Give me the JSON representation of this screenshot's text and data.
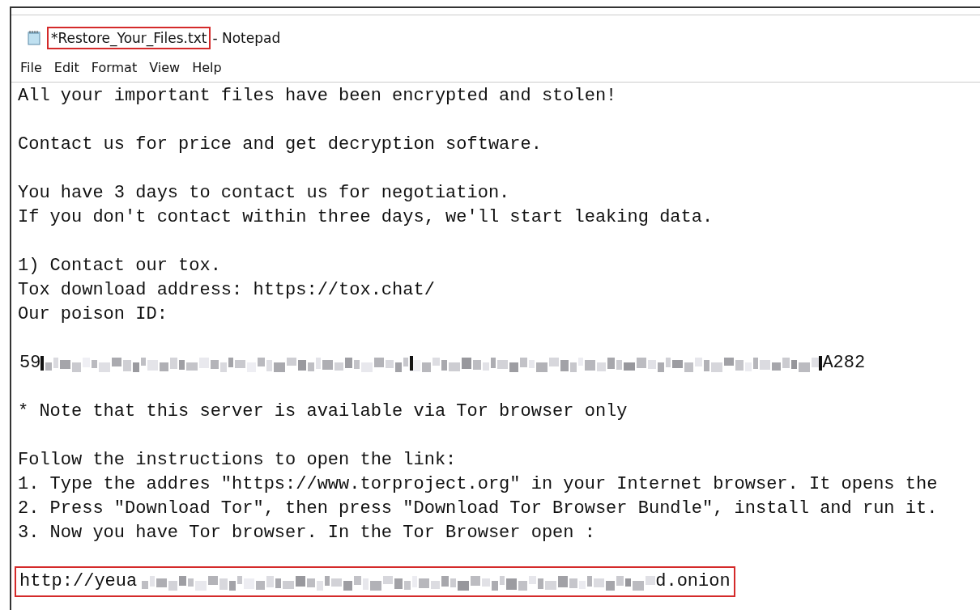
{
  "window": {
    "file_name": "*Restore_Your_Files.txt",
    "file_name_highlighted": true,
    "app_name": "- Notepad"
  },
  "menu": [
    "File",
    "Edit",
    "Format",
    "View",
    "Help"
  ],
  "lines": [
    {
      "kind": "text",
      "text": "All your important files have been encrypted and stolen!"
    },
    {
      "kind": "blank"
    },
    {
      "kind": "text",
      "text": "Contact us for price and get decryption software."
    },
    {
      "kind": "blank"
    },
    {
      "kind": "text",
      "text": "You have 3 days to contact us for negotiation."
    },
    {
      "kind": "text",
      "text": "If you don't contact within three days, we'll start leaking data."
    },
    {
      "kind": "blank"
    },
    {
      "kind": "text",
      "text": "1) Contact our tox."
    },
    {
      "kind": "text",
      "text": "Tox download address: https://tox.chat/"
    },
    {
      "kind": "text",
      "text": "Our poison ID:"
    },
    {
      "kind": "blank"
    },
    {
      "kind": "redacted",
      "before": "59",
      "after": "A282",
      "highlighted": false
    },
    {
      "kind": "blank"
    },
    {
      "kind": "text",
      "text": "* Note that this server is available via Tor browser only"
    },
    {
      "kind": "blank"
    },
    {
      "kind": "text",
      "text": "Follow the instructions to open the link:"
    },
    {
      "kind": "text",
      "text": "1. Type the addres \"https://www.torproject.org\" in your Internet browser. It opens the"
    },
    {
      "kind": "text",
      "text": "2. Press \"Download Tor\", then press \"Download Tor Browser Bundle\", install and run it."
    },
    {
      "kind": "text",
      "text": "3. Now you have Tor browser. In the Tor Browser open :"
    },
    {
      "kind": "blank"
    },
    {
      "kind": "redacted",
      "before": "http://yeua",
      "after": "d.onion",
      "highlighted": true
    }
  ]
}
